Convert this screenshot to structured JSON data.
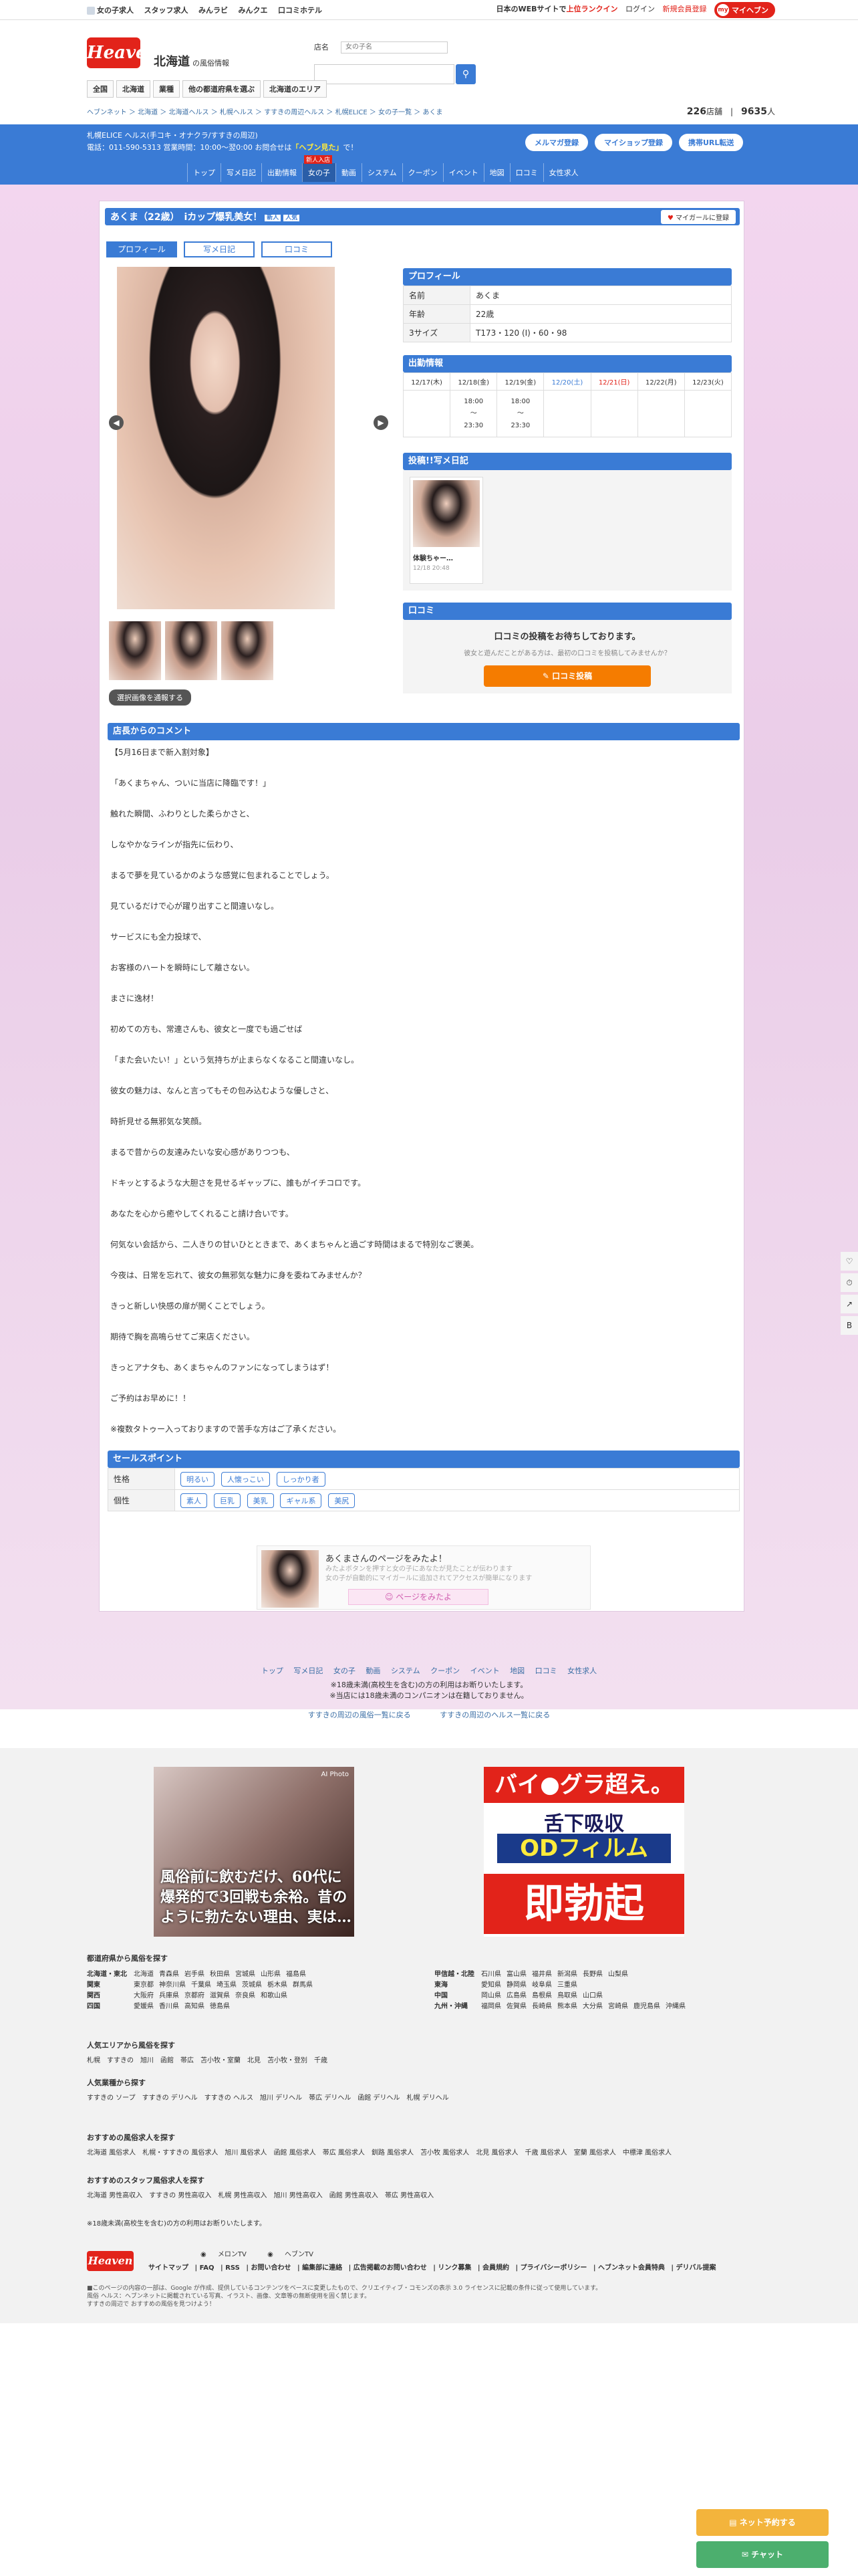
{
  "top": {
    "links": [
      "女の子求人",
      "スタッフ求人",
      "みんラビ",
      "みんクエ",
      "口コミホテル"
    ],
    "site_note": "日本のWEBサイトで",
    "site_note_rank": "上位ランクイン",
    "login": "ログイン",
    "register": "新規会員登録",
    "my": "マイヘブン"
  },
  "header": {
    "logo": "Heaven",
    "region": "北海道",
    "region_sub": "の風俗情報",
    "search_label": "店名",
    "search_query": "女の子名",
    "search_placeholder": "",
    "nav": [
      "全国",
      "北海道",
      "業種",
      "他の都道府県を選ぶ",
      "北海道のエリア"
    ]
  },
  "breadcrumb": {
    "path": "ヘブンネット ＞ 北海道 ＞ 北海道ヘルス ＞ 札幌ヘルス ＞ すすきの周辺ヘルス ＞ 札幌ELICE ＞ 女の子一覧 ＞ あくま",
    "count_shops": "226",
    "count_shops_unit": "店舗",
    "count_girls": "9635",
    "count_girls_unit": "人"
  },
  "shop": {
    "name": "札幌ELICE ヘルス(手コキ・オナクラ/すすきの周辺)",
    "line2": "電話：011-590-5313 営業時間：10:00～翌0:00 お問合せは",
    "highlight": "「ヘブン見た」",
    "line2_end": "で！",
    "buttons": [
      "メルマガ登録",
      "マイショップ登録",
      "携帯URL転送"
    ],
    "menu": [
      "トップ",
      "写メ日記",
      "出勤情報",
      "女の子",
      "動画",
      "システム",
      "クーポン",
      "イベント",
      "地図",
      "口コミ",
      "女性求人"
    ]
  },
  "girl": {
    "title": "あくま（22歳）　iカップ爆乳美女！",
    "tags": [
      "新人",
      "人気"
    ],
    "fav": "マイガールに登録",
    "tabs": [
      "プロフィール",
      "写メ日記",
      "口コミ"
    ],
    "img_button": "選択画像を通報する"
  },
  "profile": {
    "heading": "プロフィール",
    "rows": [
      [
        "名前",
        "あくま"
      ],
      [
        "年齢",
        "22歳"
      ],
      [
        "3サイズ",
        "T173・120 (I)・60・98"
      ]
    ]
  },
  "schedule": {
    "heading": "出勤情報",
    "days": [
      "12/17(木)",
      "12/18(金)",
      "12/19(金)",
      "12/20(土)",
      "12/21(日)",
      "12/22(月)",
      "12/23(火)"
    ],
    "slots": [
      [
        "18:00",
        "23:30"
      ],
      [
        "18:00",
        "23:30"
      ],
      [],
      [],
      [],
      [],
      []
    ]
  },
  "diary": {
    "heading": "投稿!!写メ日記",
    "title": "体験ちゃー…",
    "date": "12/18 20:48"
  },
  "review": {
    "heading": "口コミ",
    "msg": "口コミの投稿をお待ちしております。",
    "sub": "彼女と遊んだことがある方は、最初の口コミを投稿してみませんか？",
    "button": "口コミ投稿"
  },
  "comment": {
    "heading": "店長からのコメント",
    "lines": [
      "【5月16日まで新入割対象】",
      "「あくまちゃん、ついに当店に降臨です！」",
      "触れた瞬間、ふわりとした柔らかさと、",
      "しなやかなラインが指先に伝わり、",
      "まるで夢を見ているかのような感覚に包まれることでしょう。",
      "見ているだけで心が躍り出すこと間違いなし。",
      "サービスにも全力投球で、",
      "お客様のハートを瞬時にして離さない。",
      "まさに逸材！",
      "初めての方も、常連さんも、彼女と一度でも過ごせば",
      "「また会いたい！」という気持ちが止まらなくなること間違いなし。",
      "彼女の魅力は、なんと言ってもその包み込むような優しさと、",
      "時折見せる無邪気な笑顔。",
      "まるで昔からの友達みたいな安心感がありつつも、",
      "ドキッとするような大胆さを見せるギャップに、誰もがイチコロです。",
      "あなたを心から癒やしてくれること請け合いです。",
      "何気ない会話から、二人きりの甘いひとときまで、あくまちゃんと過ごす時間はまるで特別なご褒美。",
      "今夜は、日常を忘れて、彼女の無邪気な魅力に身を委ねてみませんか？",
      "きっと新しい快感の扉が開くことでしょう。",
      "期待で胸を高鳴らせてご来店ください。",
      "きっとアナタも、あくまちゃんのファンになってしまうはず！",
      "ご予約はお早めに！！",
      "※複数タトゥー入っておりますので苦手な方はご了承ください。"
    ]
  },
  "points": {
    "heading": "セールスポイント",
    "rows": [
      {
        "label": "性格",
        "items": [
          "明るい",
          "人懐っこい",
          "しっかり者"
        ]
      },
      {
        "label": "個性",
        "items": [
          "素人",
          "巨乳",
          "美乳",
          "ギャル系",
          "美尻"
        ]
      }
    ]
  },
  "fan": {
    "t1": "あくまさんのページをみたよ！",
    "t2a": "みたよボタンを押すと女の子にあなたが見たことが伝わります",
    "t2b": "女の子が自動的にマイガールに追加されてアクセスが簡単になります",
    "button": "ページをみたよ"
  },
  "footer": {
    "nav": [
      "トップ",
      "写メ日記",
      "女の子",
      "動画",
      "システム",
      "クーポン",
      "イベント",
      "地図",
      "口コミ",
      "女性求人"
    ],
    "warn1": "※18歳未満(高校生を含む)の方の利用はお断りいたします。",
    "warn2": "※当店には18歳未満のコンパニオンは在籍しておりません。",
    "back1": "すすきの周辺の風俗一覧に戻る",
    "back2": "すすきの周辺のヘルス一覧に戻る"
  },
  "ads": {
    "ad1": "風俗前に飲むだけ、60代に爆発的で3回戦も余裕。昔のように勃たない理由、実は…",
    "ad1_tag": "AI Photo",
    "ad2_h1": "バイ●グラ超え。",
    "ad2_h2": "舌下吸収",
    "ad2_h3": "ODフィルム",
    "ad2_h4": "即勃起"
  },
  "prefs": {
    "heading": "都道府県から風俗を探す",
    "left": [
      [
        "北海道・東北",
        "北海道",
        "青森県",
        "岩手県",
        "秋田県",
        "宮城県",
        "山形県",
        "福島県"
      ],
      [
        "関東",
        "東京都",
        "神奈川県",
        "千葉県",
        "埼玉県",
        "茨城県",
        "栃木県",
        "群馬県"
      ],
      [
        "関西",
        "大阪府",
        "兵庫県",
        "京都府",
        "滋賀県",
        "奈良県",
        "和歌山県"
      ],
      [
        "四国",
        "愛媛県",
        "香川県",
        "高知県",
        "徳島県"
      ]
    ],
    "right": [
      [
        "甲信越・北陸",
        "石川県",
        "富山県",
        "福井県",
        "新潟県",
        "長野県",
        "山梨県"
      ],
      [
        "東海",
        "愛知県",
        "静岡県",
        "岐阜県",
        "三重県"
      ],
      [
        "中国",
        "岡山県",
        "広島県",
        "島根県",
        "鳥取県",
        "山口県"
      ],
      [
        "九州・沖縄",
        "福岡県",
        "佐賀県",
        "長崎県",
        "熊本県",
        "大分県",
        "宮崎県",
        "鹿児島県",
        "沖縄県"
      ]
    ]
  },
  "popular_area": {
    "heading": "人気エリアから風俗を探す",
    "items": [
      "札幌",
      "すすきの",
      "旭川",
      "函館",
      "帯広",
      "苫小牧・室蘭",
      "北見",
      "苫小牧・登別",
      "千歳"
    ]
  },
  "popular_type": {
    "heading": "人気業種から探す",
    "items": [
      "すすきの ソープ",
      "すすきの デリヘル",
      "すすきの ヘルス",
      "旭川 デリヘル",
      "帯広 デリヘル",
      "函館 デリヘル",
      "札幌 デリヘル"
    ]
  },
  "rec_girl": {
    "heading": "おすすめの風俗求人を探す",
    "items": [
      "北海道 風俗求人",
      "札幌・すすきの 風俗求人",
      "旭川 風俗求人",
      "函館 風俗求人",
      "帯広 風俗求人",
      "釧路 風俗求人",
      "苫小牧 風俗求人",
      "北見 風俗求人",
      "千歳 風俗求人",
      "室蘭 風俗求人",
      "中標津 風俗求人"
    ]
  },
  "rec_staff": {
    "heading": "おすすめのスタッフ風俗求人を探す",
    "items": [
      "北海道 男性高収入",
      "すすきの 男性高収入",
      "札幌 男性高収入",
      "旭川 男性高収入",
      "函館 男性高収入",
      "帯広 男性高収入"
    ]
  },
  "bottom": {
    "warn": "※18歳未満(高校生を含む)の方の利用はお断りいたします。",
    "logo": "Heaven",
    "apps": [
      "メロンTV",
      "ヘブンTV"
    ],
    "links": [
      "サイトマップ",
      "FAQ",
      "RSS",
      "お問い合わせ",
      "編集部に連絡",
      "広告掲載のお問い合わせ",
      "リンク募集",
      "会員規約",
      "プライバシーポリシー",
      "ヘブンネット会員特典",
      "デリバル提案"
    ],
    "note1": "■このページの内容の一部は、Google が作成、提供しているコンテンツをベースに変更したもので、クリエイティブ・コモンズの表示 3.0 ライセンスに記載の条件に従って使用しています。",
    "note2": "風俗 ヘルス：ヘブンネットに掲載されている写真、イラスト、画像、文章等の無断使用を固く禁じます。",
    "note3": "すすきの周辺で おすすめの風俗を見つけよう！"
  },
  "side": [
    "♡",
    "⏱",
    "↗",
    "B"
  ],
  "float": {
    "yellow": "ネット予約する",
    "green": "チャット"
  }
}
